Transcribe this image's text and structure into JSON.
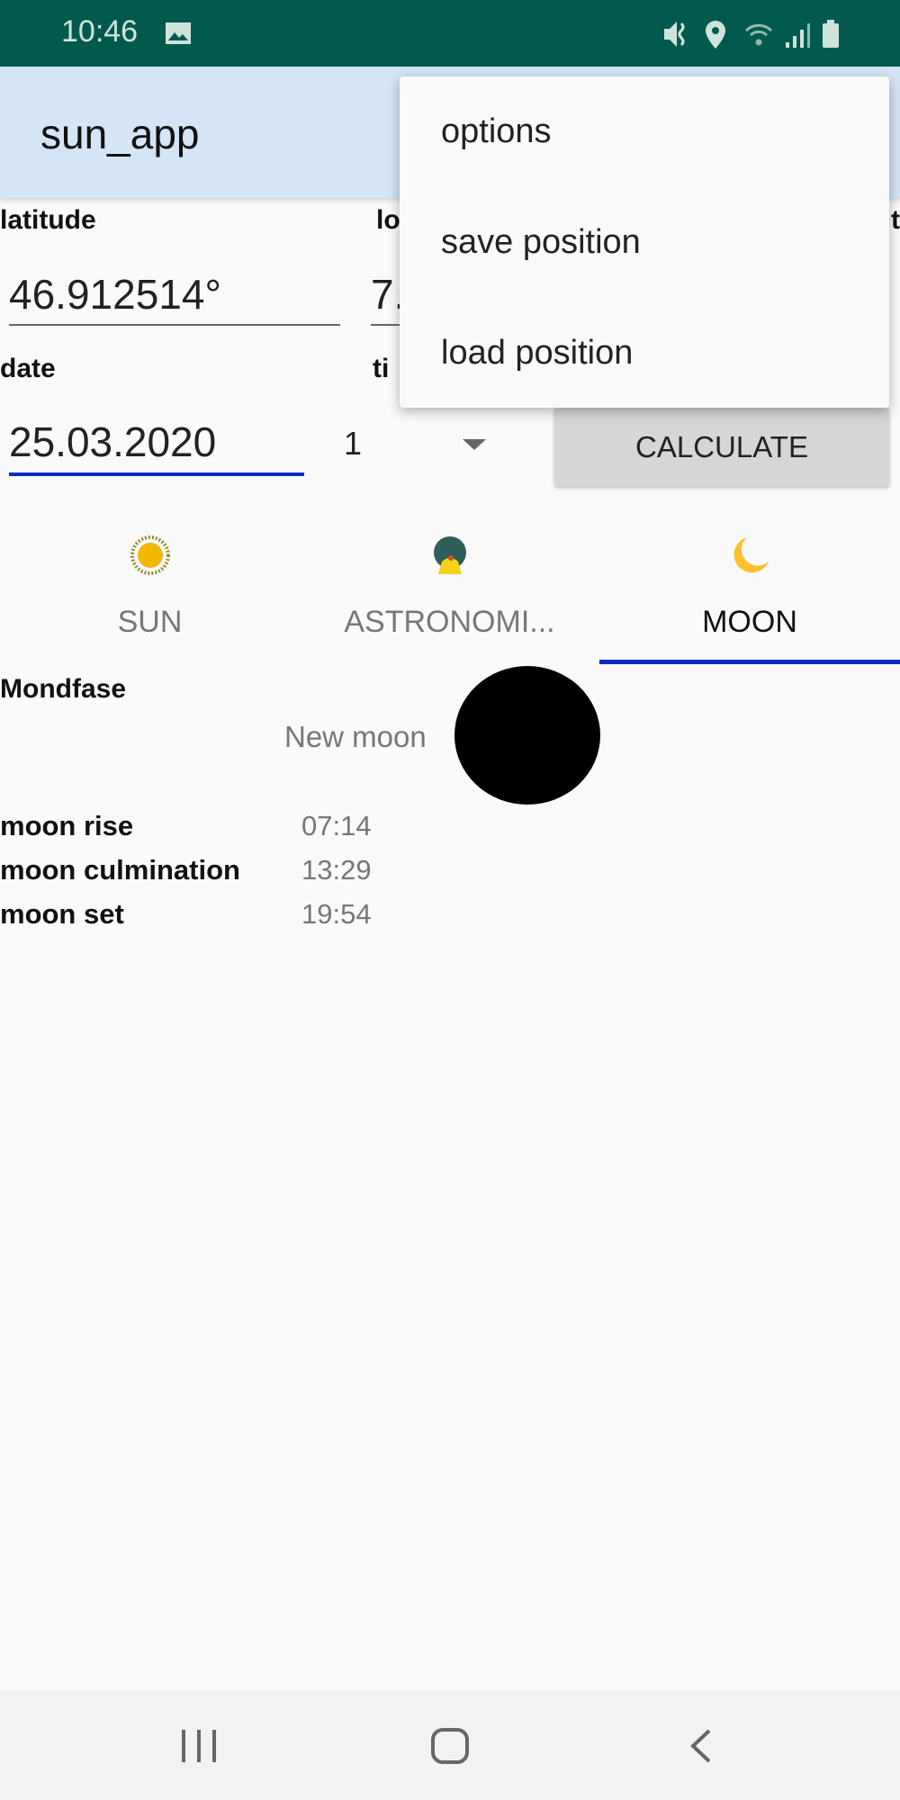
{
  "status_bar": {
    "time": "10:46",
    "icons": [
      "image-icon",
      "mute-vibrate-icon",
      "location-icon",
      "wifi-icon",
      "signal-icon",
      "battery-icon"
    ]
  },
  "app_bar": {
    "title": "sun_app"
  },
  "menu": {
    "items": [
      "options",
      "save position",
      "load position"
    ]
  },
  "form": {
    "latitude_label": "latitude",
    "latitude_value": "46.912514°",
    "longitude_label_partial": "lo",
    "longitude_value_partial": "7.",
    "third_label_partial": "t",
    "date_label": "date",
    "date_value": "25.03.2020",
    "time_label_partial": "ti",
    "timezone_value": "1",
    "calculate_label": "CALCULATE"
  },
  "tabs": [
    {
      "label": "SUN",
      "icon": "sun-icon"
    },
    {
      "label": "ASTRONOMI...",
      "icon": "astronomical-icon"
    },
    {
      "label": "MOON",
      "icon": "moon-icon",
      "selected": true
    }
  ],
  "moon": {
    "phase_label": "Mondfase",
    "phase_value": "New moon",
    "rows": [
      {
        "label": "moon rise",
        "value": "07:14"
      },
      {
        "label": "moon culmination",
        "value": "13:29"
      },
      {
        "label": "moon set",
        "value": "19:54"
      }
    ]
  },
  "colors": {
    "status_bar": "#02594d",
    "app_bar": "#d4e5f7",
    "accent": "#1029c4",
    "sun": "#f2b705",
    "moon": "#fbc02d"
  }
}
